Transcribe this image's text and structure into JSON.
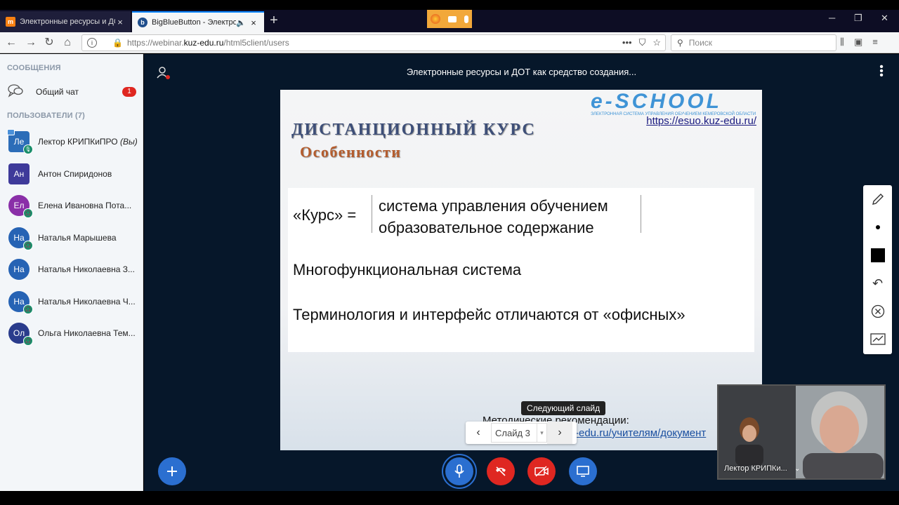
{
  "browser": {
    "tabs": [
      {
        "title": "Электронные ресурсы и ДОТ",
        "favicon": "m",
        "active": false
      },
      {
        "title": "BigBlueButton - Электронн",
        "favicon": "b",
        "active": true
      }
    ],
    "url_prefix": "https://webinar.",
    "url_host": "kuz-edu.ru",
    "url_path": "/html5client/users",
    "search_placeholder": "Поиск"
  },
  "sidebar": {
    "messages_header": "СООБЩЕНИЯ",
    "public_chat_label": "Общий чат",
    "unread_count": "1",
    "users_header": "ПОЛЬЗОВАТЕЛИ (7)",
    "users": [
      {
        "initials": "Ле",
        "name": "Лектор КРИПКиПРО",
        "suffix": "(Вы)",
        "color": "#2c6db8",
        "moderator": true
      },
      {
        "initials": "Ан",
        "name": "Антон Спиридонов",
        "color": "#3e3a9a",
        "moderator": true
      },
      {
        "initials": "Ел",
        "name": "Елена Ивановна Пота...",
        "color": "#8a2fa8",
        "moderator": false
      },
      {
        "initials": "На",
        "name": "Наталья Марышева",
        "color": "#2663b4",
        "moderator": false
      },
      {
        "initials": "На",
        "name": "Наталья Николаевна З...",
        "color": "#2663b4",
        "moderator": false
      },
      {
        "initials": "На",
        "name": "Наталья Николаевна Ч...",
        "color": "#2663b4",
        "moderator": false
      },
      {
        "initials": "Ол",
        "name": "Ольга Николаевна Тем...",
        "color": "#2a3c8c",
        "moderator": false
      }
    ]
  },
  "main": {
    "title": "Электронные ресурсы и ДОТ как средство создания..."
  },
  "slide": {
    "logo_text": "e-SCHOOL",
    "logo_subtext": "ЭЛЕКТРОННАЯ СИСТЕМА УПРАВЛЕНИЯ ОБУЧЕНИЕМ КЕМЕРОВСКОЙ ОБЛАСТИ",
    "link": "https://esuo.kuz-edu.ru/",
    "title": "ДИСТАНЦИОННЫЙ КУРС",
    "subtitle": "Особенности",
    "kurs_label": "«Курс» =",
    "kurs_line1": "система управления обучением",
    "kurs_line2": "образовательное содержание",
    "line2": "Многофункциональная система",
    "line3": "Терминология и интерфейс отличаются от «офисных»",
    "footer_text": "Методические рекомендации:",
    "footer_link": "-edu.ru/учителям/документ"
  },
  "slide_nav": {
    "current": "Слайд 3",
    "tooltip": "Следующий слайд"
  },
  "webcam": {
    "label": "Лектор КРИПКи..."
  },
  "colors": {
    "accent": "#2b6fd0",
    "danger": "#df2721",
    "bg_main": "#06172a"
  }
}
